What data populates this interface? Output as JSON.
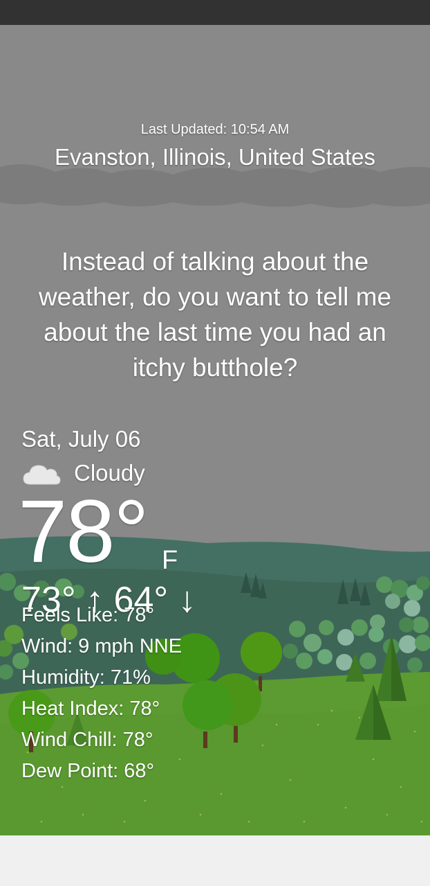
{
  "header": {
    "last_updated": "Last Updated: 10:54 AM",
    "location": "Evanston, Illinois, United States"
  },
  "quip": "Instead of talking about the weather, do you want to tell me about the last time you had an itchy butthole?",
  "current": {
    "date": "Sat, July 06",
    "condition": "Cloudy",
    "condition_icon": "cloud-icon",
    "temperature": "78°",
    "unit": "F",
    "hi_lo": "73° ↑ 64° ↓"
  },
  "details": [
    "Feels Like: 78°",
    "Wind: 9 mph NNE",
    "Humidity: 71%",
    "Heat Index: 78°",
    "Wind Chill: 78°",
    "Dew Point: 68°"
  ],
  "colors": {
    "sky": "#898989",
    "cloud_band": "#7a7a7a",
    "far_hills": "#3f6b5a",
    "meadow": "#5a9a31",
    "status_bar": "#323232"
  }
}
